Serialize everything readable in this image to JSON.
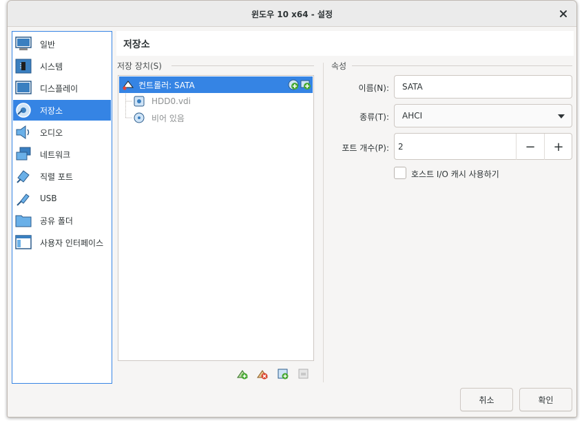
{
  "window": {
    "title": "윈도우 10 x64 - 설정"
  },
  "sidebar": {
    "items": [
      {
        "label": "일반",
        "icon": "general-icon"
      },
      {
        "label": "시스템",
        "icon": "system-icon"
      },
      {
        "label": "디스플레이",
        "icon": "display-icon"
      },
      {
        "label": "저장소",
        "icon": "storage-icon",
        "active": true
      },
      {
        "label": "오디오",
        "icon": "audio-icon"
      },
      {
        "label": "네트워크",
        "icon": "network-icon"
      },
      {
        "label": "직렬 포트",
        "icon": "serial-port-icon"
      },
      {
        "label": "USB",
        "icon": "usb-icon"
      },
      {
        "label": "공유 폴더",
        "icon": "shared-folder-icon"
      },
      {
        "label": "사용자 인터페이스",
        "icon": "user-interface-icon"
      }
    ]
  },
  "page": {
    "title": "저장소"
  },
  "storage": {
    "group_label": "저장 장치(S)",
    "controller": {
      "label": "컨트롤러: SATA"
    },
    "children": [
      {
        "label": "HDD0.vdi",
        "icon": "hard-disk-icon"
      },
      {
        "label": "비어 있음",
        "icon": "optical-disc-icon"
      }
    ]
  },
  "attributes": {
    "group_label": "속성",
    "name_label": "이름(N):",
    "name_value": "SATA",
    "type_label": "종류(T):",
    "type_value": "AHCI",
    "port_label": "포트 개수(P):",
    "port_value": "2",
    "cache_label": "호스트 I/O 캐시 사용하기",
    "cache_checked": false
  },
  "buttons": {
    "cancel": "취소",
    "ok": "확인"
  }
}
